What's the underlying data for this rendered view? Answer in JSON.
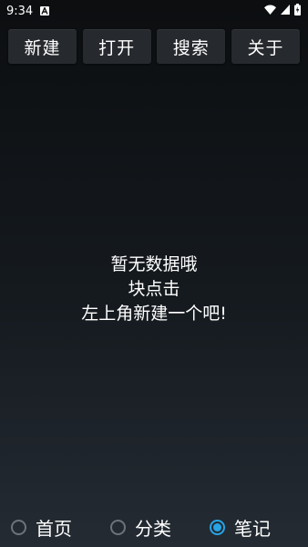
{
  "status_bar": {
    "time": "9:34",
    "notification_icon": "text-a-icon",
    "wifi_icon": "wifi-icon",
    "signal_icon": "cell-signal-icon",
    "battery_icon": "battery-charging-icon"
  },
  "toolbar": {
    "new_label": "新建",
    "open_label": "打开",
    "search_label": "搜索",
    "about_label": "关于"
  },
  "empty_state": {
    "line1": "暂无数据哦",
    "line2": "块点击",
    "line3": "左上角新建一个吧!"
  },
  "bottom_nav": {
    "items": [
      {
        "label": "首页",
        "selected": false
      },
      {
        "label": "分类",
        "selected": false
      },
      {
        "label": "笔记",
        "selected": true
      }
    ],
    "accent_color": "#27a4e6"
  }
}
